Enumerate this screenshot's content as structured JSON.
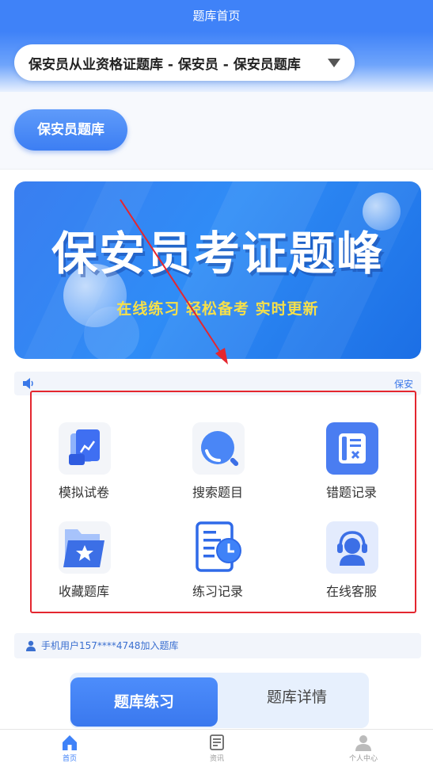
{
  "header": {
    "title": "题库首页"
  },
  "bank_selector": {
    "value": "保安员从业资格证题库 - 保安员 - 保安员题库"
  },
  "category_pill": {
    "label": "保安员题库"
  },
  "banner": {
    "title": "保安员考证题峰",
    "subtitle": "在线练习 轻松备考 实时更新"
  },
  "notice": {
    "scroll_text": "保安"
  },
  "menu": [
    {
      "label": "模拟试卷",
      "icon": "exam-paper-icon"
    },
    {
      "label": "搜索题目",
      "icon": "search-icon"
    },
    {
      "label": "错题记录",
      "icon": "wrong-record-icon"
    },
    {
      "label": "收藏题库",
      "icon": "favorite-folder-icon"
    },
    {
      "label": "练习记录",
      "icon": "practice-record-icon"
    },
    {
      "label": "在线客服",
      "icon": "customer-service-icon"
    }
  ],
  "join_notice": {
    "text": "手机用户157****4748加入题库"
  },
  "tabs": {
    "active": "题库练习",
    "other": "题库详情"
  },
  "bottom_nav": [
    {
      "label": "首页",
      "icon": "home-icon",
      "active": true
    },
    {
      "label": "资讯",
      "icon": "news-icon",
      "active": false
    },
    {
      "label": "个人中心",
      "icon": "profile-icon",
      "active": false
    }
  ],
  "colors": {
    "primary": "#3f82f8",
    "highlight_frame": "#e4262f",
    "banner_subtitle": "#f6e04a"
  }
}
